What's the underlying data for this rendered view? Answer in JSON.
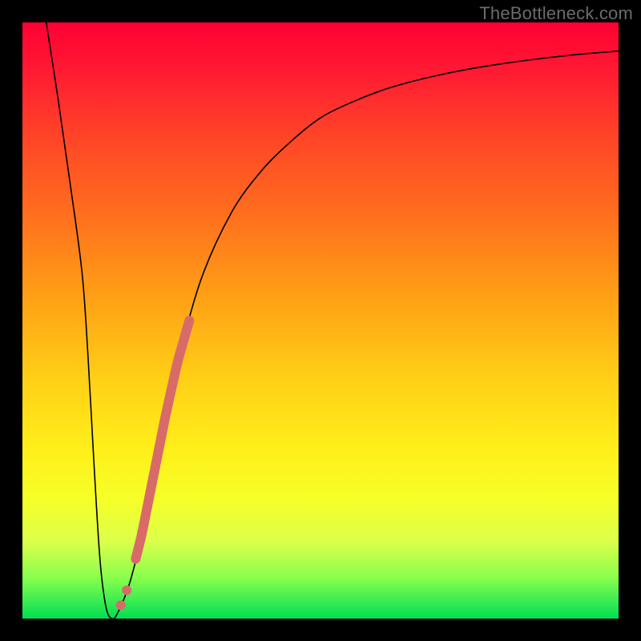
{
  "attribution": "TheBottleneck.com",
  "colors": {
    "gradient_top": "#ff0033",
    "gradient_bottom": "#00de54",
    "line": "#000000",
    "highlight": "#d86b68",
    "frame": "#000000"
  },
  "chart_data": {
    "type": "line",
    "title": "",
    "xlabel": "",
    "ylabel": "",
    "xlim": [
      0,
      100
    ],
    "ylim": [
      0,
      100
    ],
    "x": [
      4,
      6,
      8,
      10,
      11,
      12,
      13,
      14,
      15,
      16,
      18,
      20,
      22,
      24,
      26,
      30,
      35,
      40,
      45,
      50,
      55,
      60,
      65,
      70,
      75,
      80,
      85,
      90,
      95,
      100
    ],
    "values": [
      100,
      87,
      73,
      58,
      44,
      26,
      10,
      2,
      0,
      1,
      6,
      14,
      24,
      34,
      43,
      57,
      68,
      75,
      80,
      84,
      86.5,
      88.5,
      90,
      91.2,
      92.2,
      93,
      93.7,
      94.3,
      94.8,
      95.2
    ],
    "annotations": {
      "highlight_segment_x": [
        19,
        28
      ],
      "highlight_dots_x": [
        16.5,
        17.5
      ]
    }
  }
}
